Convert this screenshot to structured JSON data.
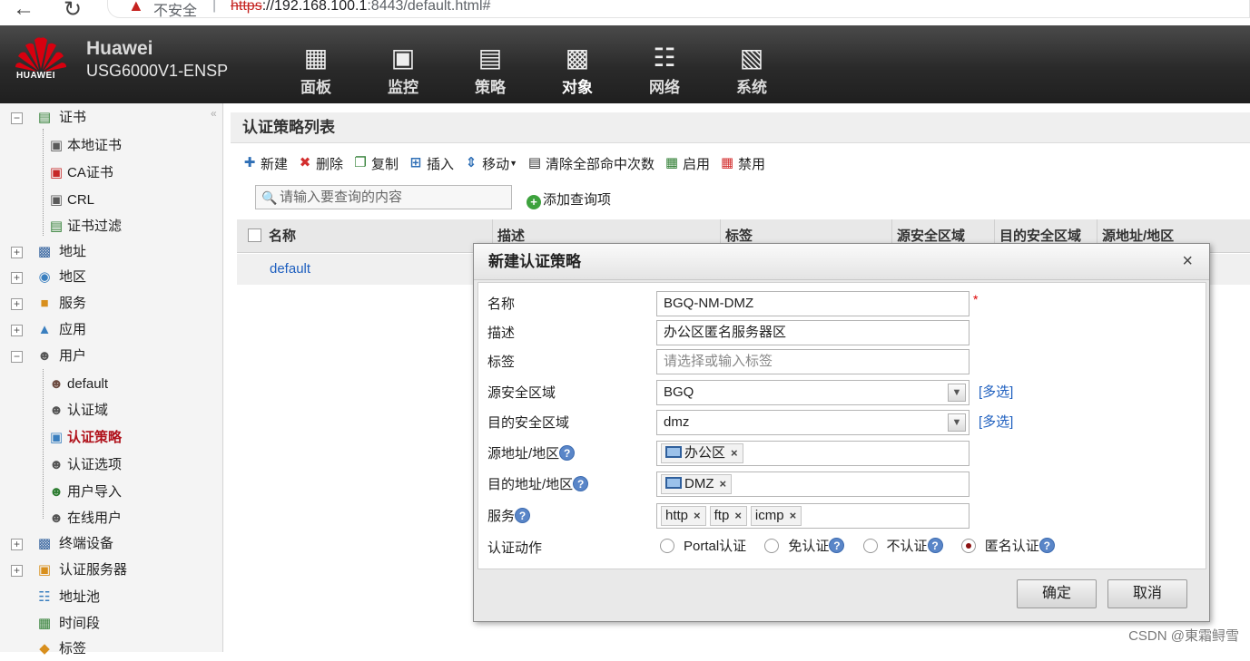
{
  "browser": {
    "insecure_label": "不安全",
    "separator": "|",
    "url_scheme": "https",
    "url_host": "://192.168.100.1",
    "url_rest": ":8443/default.html#"
  },
  "header": {
    "logo_text": "HUAWEI",
    "brand": "Huawei",
    "model": "USG6000V1-ENSP",
    "nav": [
      {
        "label": "面板",
        "icon": "dashboard-icon"
      },
      {
        "label": "监控",
        "icon": "monitor-icon"
      },
      {
        "label": "策略",
        "icon": "policy-icon"
      },
      {
        "label": "对象",
        "icon": "object-icon"
      },
      {
        "label": "网络",
        "icon": "network-icon"
      },
      {
        "label": "系统",
        "icon": "system-icon"
      }
    ],
    "active_nav": "对象"
  },
  "sidebar": {
    "items": [
      {
        "label": "证书",
        "level": 0,
        "expanded": true
      },
      {
        "label": "本地证书",
        "level": 1
      },
      {
        "label": "CA证书",
        "level": 1
      },
      {
        "label": "CRL",
        "level": 1
      },
      {
        "label": "证书过滤",
        "level": 1
      },
      {
        "label": "地址",
        "level": 0,
        "expanded": false
      },
      {
        "label": "地区",
        "level": 0,
        "expanded": false
      },
      {
        "label": "服务",
        "level": 0,
        "expanded": false
      },
      {
        "label": "应用",
        "level": 0,
        "expanded": false
      },
      {
        "label": "用户",
        "level": 0,
        "expanded": true
      },
      {
        "label": "default",
        "level": 1
      },
      {
        "label": "认证域",
        "level": 1
      },
      {
        "label": "认证策略",
        "level": 1,
        "selected": true
      },
      {
        "label": "认证选项",
        "level": 1
      },
      {
        "label": "用户导入",
        "level": 1
      },
      {
        "label": "在线用户",
        "level": 1
      },
      {
        "label": "终端设备",
        "level": 0,
        "expanded": false
      },
      {
        "label": "认证服务器",
        "level": 0,
        "expanded": false
      },
      {
        "label": "地址池",
        "level": 0
      },
      {
        "label": "时间段",
        "level": 0
      },
      {
        "label": "标签",
        "level": 0
      }
    ]
  },
  "main": {
    "title": "认证策略列表",
    "toolbar": {
      "new": "新建",
      "delete": "删除",
      "copy": "复制",
      "insert": "插入",
      "move": "移动",
      "clear_hits": "清除全部命中次数",
      "enable": "启用",
      "disable": "禁用"
    },
    "search_placeholder": "请输入要查询的内容",
    "add_query": "添加查询项",
    "columns": [
      "名称",
      "描述",
      "标签",
      "源安全区域",
      "目的安全区域",
      "源地址/地区"
    ],
    "rows": [
      {
        "name": "default"
      }
    ]
  },
  "dialog": {
    "title": "新建认证策略",
    "fields": {
      "name_label": "名称",
      "name_value": "BGQ-NM-DMZ",
      "required_mark": "*",
      "desc_label": "描述",
      "desc_value": "办公区匿名服务器区",
      "tag_label": "标签",
      "tag_placeholder": "请选择或输入标签",
      "src_zone_label": "源安全区域",
      "src_zone_value": "BGQ",
      "dst_zone_label": "目的安全区域",
      "dst_zone_value": "dmz",
      "multi_select": "[多选]",
      "src_addr_label": "源地址/地区",
      "src_addr_tags": [
        "办公区"
      ],
      "dst_addr_label": "目的地址/地区",
      "dst_addr_tags": [
        "DMZ"
      ],
      "service_label": "服务",
      "service_tags": [
        "http",
        "ftp",
        "icmp"
      ],
      "action_label": "认证动作",
      "actions": [
        {
          "label": "Portal认证",
          "help": false
        },
        {
          "label": "免认证",
          "help": true
        },
        {
          "label": "不认证",
          "help": true
        },
        {
          "label": "匿名认证",
          "help": true
        }
      ],
      "selected_action": "匿名认证"
    },
    "ok": "确定",
    "cancel": "取消",
    "close_glyph": "×",
    "tag_remove_glyph": "×",
    "help_glyph": "?"
  },
  "watermark": "CSDN @東霜鲟雪",
  "colors": {
    "header_bg": "#2a2a2a",
    "link": "#1e5fbf",
    "selected_tree": "#b0121b",
    "brand_red": "#d7000f"
  }
}
